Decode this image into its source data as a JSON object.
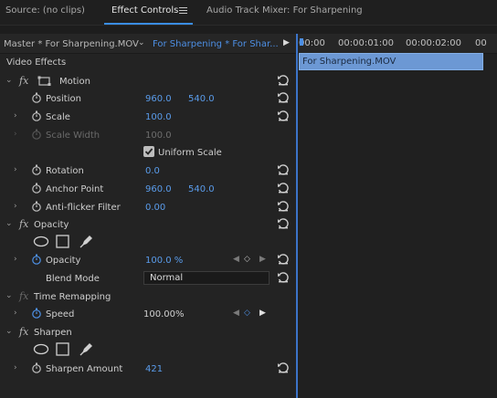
{
  "tabs": [
    {
      "label": "Source: (no clips)"
    },
    {
      "label": "Effect Controls"
    },
    {
      "label": "Audio Track Mixer: For Sharpening"
    }
  ],
  "header": {
    "master_clip": "Master * For Sharpening.MOV",
    "sequence_clip": "For Sharpening * For Shar..."
  },
  "timeline": {
    "timecodes": [
      "00:00",
      "00:00:01:00",
      "00:00:02:00",
      "00"
    ],
    "clip_name": "For Sharpening.MOV"
  },
  "section_title": "Video Effects",
  "motion": {
    "name": "Motion",
    "position": {
      "label": "Position",
      "x": "960.0",
      "y": "540.0"
    },
    "scale": {
      "label": "Scale",
      "value": "100.0"
    },
    "scale_width": {
      "label": "Scale Width",
      "value": "100.0"
    },
    "uniform_scale": {
      "label": "Uniform Scale",
      "checked": true
    },
    "rotation": {
      "label": "Rotation",
      "value": "0.0"
    },
    "anchor_point": {
      "label": "Anchor Point",
      "x": "960.0",
      "y": "540.0"
    },
    "anti_flicker": {
      "label": "Anti-flicker Filter",
      "value": "0.00"
    }
  },
  "opacity": {
    "name": "Opacity",
    "opacity": {
      "label": "Opacity",
      "value": "100.0 %"
    },
    "blend_mode": {
      "label": "Blend Mode",
      "value": "Normal"
    }
  },
  "time_remapping": {
    "name": "Time Remapping",
    "speed": {
      "label": "Speed",
      "value": "100.00%"
    }
  },
  "sharpen": {
    "name": "Sharpen",
    "amount": {
      "label": "Sharpen Amount",
      "value": "421"
    }
  },
  "icons": {
    "fx": "fx",
    "chevron": "›",
    "chevron_down": "⌄",
    "key_left": "◀",
    "key_right": "▶",
    "key_diamond": "◇",
    "play": "▶",
    "menu": "≡"
  },
  "colors": {
    "accent": "#4d8fe4",
    "clip": "#6c98d4",
    "value": "#5a9ceb"
  }
}
